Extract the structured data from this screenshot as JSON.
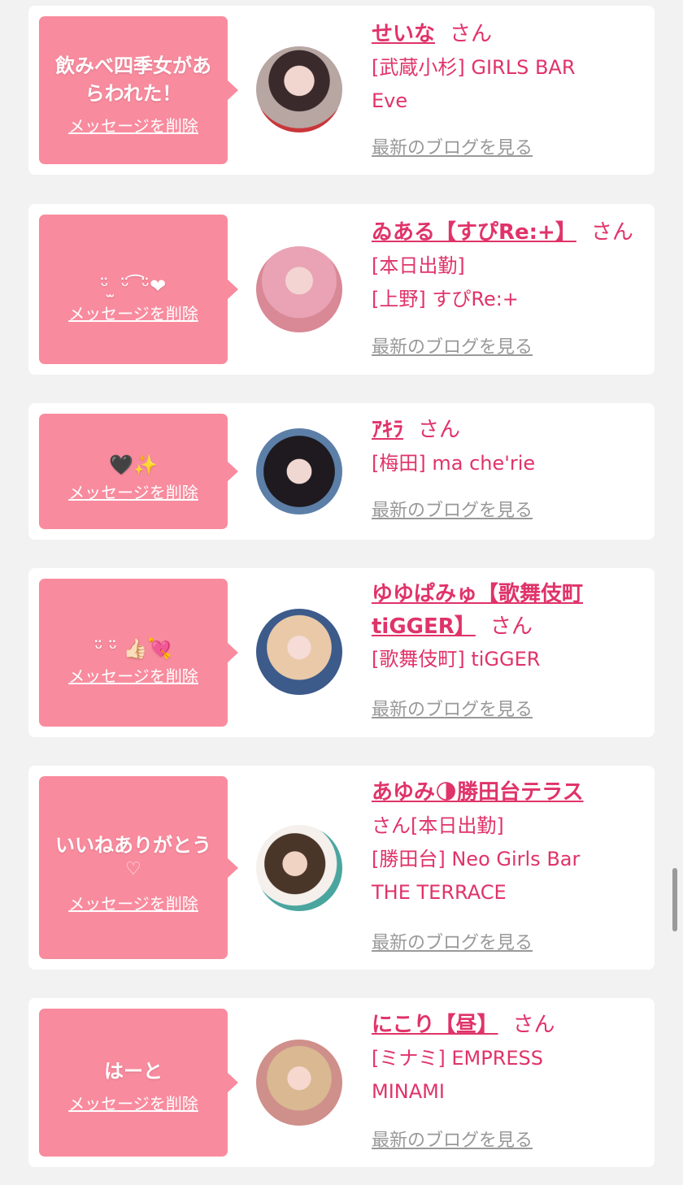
{
  "delete_label": "メッセージを削除",
  "blog_label": "最新のブログを見る",
  "san_label": "さん",
  "colors": {
    "accent": "#e0336a",
    "bubble": "#f98b9e",
    "link_gray": "#999999",
    "background": "#f2f2f2"
  },
  "cards": [
    {
      "message": "飲みべ四季女があらわれた！",
      "name": "せいな",
      "lines": [
        "[武蔵小杉] GIRLS BAR",
        "Eve"
      ]
    },
    {
      "message": "ᵕ̈ ̫ ᵕ̈ ͡ ᵕ̈❤",
      "name": "ゐある【すぴRe:+】",
      "lines": [
        "[本日出勤]",
        "[上野] すぴRe:+"
      ]
    },
    {
      "message": "🖤✨",
      "name": "ｱｷﾗ",
      "lines": [
        "[梅田] ma che'rie"
      ]
    },
    {
      "message": "ᵕ̈ ᵕ̈ 👍🏻💘",
      "name": "ゆゆぱみゅ【歌舞伎町tiGGER】",
      "lines": [
        "[歌舞伎町] tiGGER"
      ]
    },
    {
      "message": "いいねありがとう",
      "heart": "♡",
      "name": "あゆみ🌗勝田台テラス",
      "tail": "[本日出勤]",
      "lines": [
        "[勝田台] Neo Girls Bar",
        "THE TERRACE"
      ]
    },
    {
      "message": "はーと",
      "name": "にこり【昼】",
      "lines": [
        "[ミナミ] EMPRESS",
        "MINAMI"
      ]
    }
  ]
}
